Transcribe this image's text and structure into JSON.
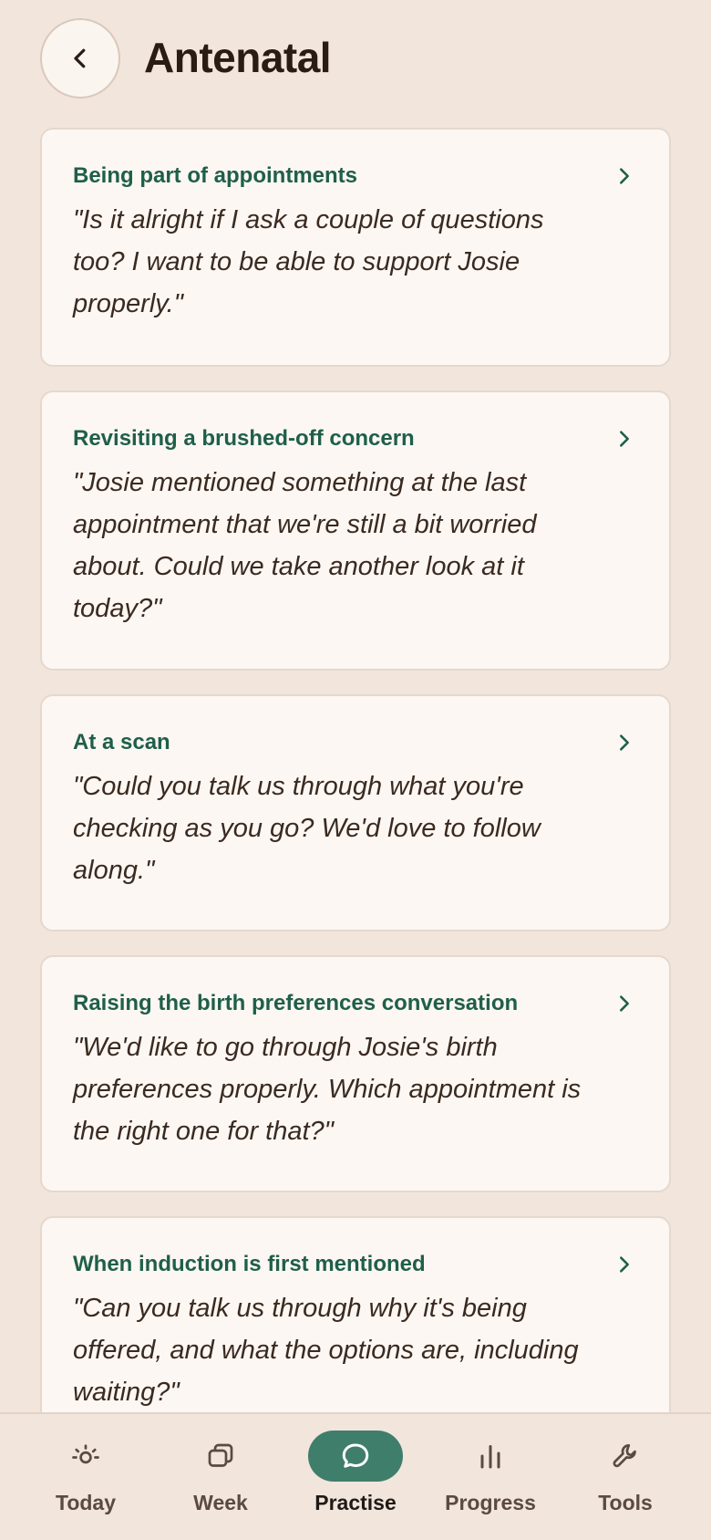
{
  "header": {
    "title": "Antenatal"
  },
  "cards": [
    {
      "title": "Being part of appointments",
      "quote": "\"Is it alright if I ask a couple of questions too? I want to be able to support Josie properly.\""
    },
    {
      "title": "Revisiting a brushed-off concern",
      "quote": "\"Josie mentioned something at the last appointment that we're still a bit worried about. Could we take another look at it today?\""
    },
    {
      "title": "At a scan",
      "quote": "\"Could you talk us through what you're checking as you go? We'd love to follow along.\""
    },
    {
      "title": "Raising the birth preferences conversation",
      "quote": "\"We'd like to go through Josie's birth preferences properly. Which appointment is the right one for that?\""
    },
    {
      "title": "When induction is first mentioned",
      "quote": "\"Can you talk us through why it's being offered, and what the options are, including waiting?\""
    }
  ],
  "tabs": [
    {
      "label": "Today",
      "icon": "sun-icon",
      "active": false
    },
    {
      "label": "Week",
      "icon": "stack-icon",
      "active": false
    },
    {
      "label": "Practise",
      "icon": "chat-bubble-icon",
      "active": true
    },
    {
      "label": "Progress",
      "icon": "bar-chart-icon",
      "active": false
    },
    {
      "label": "Tools",
      "icon": "wrench-icon",
      "active": false
    }
  ],
  "colors": {
    "background": "#f1e5dc",
    "card": "#fcf7f3",
    "accent_green": "#1f5f4a",
    "active_tab": "#3f7e6b"
  }
}
